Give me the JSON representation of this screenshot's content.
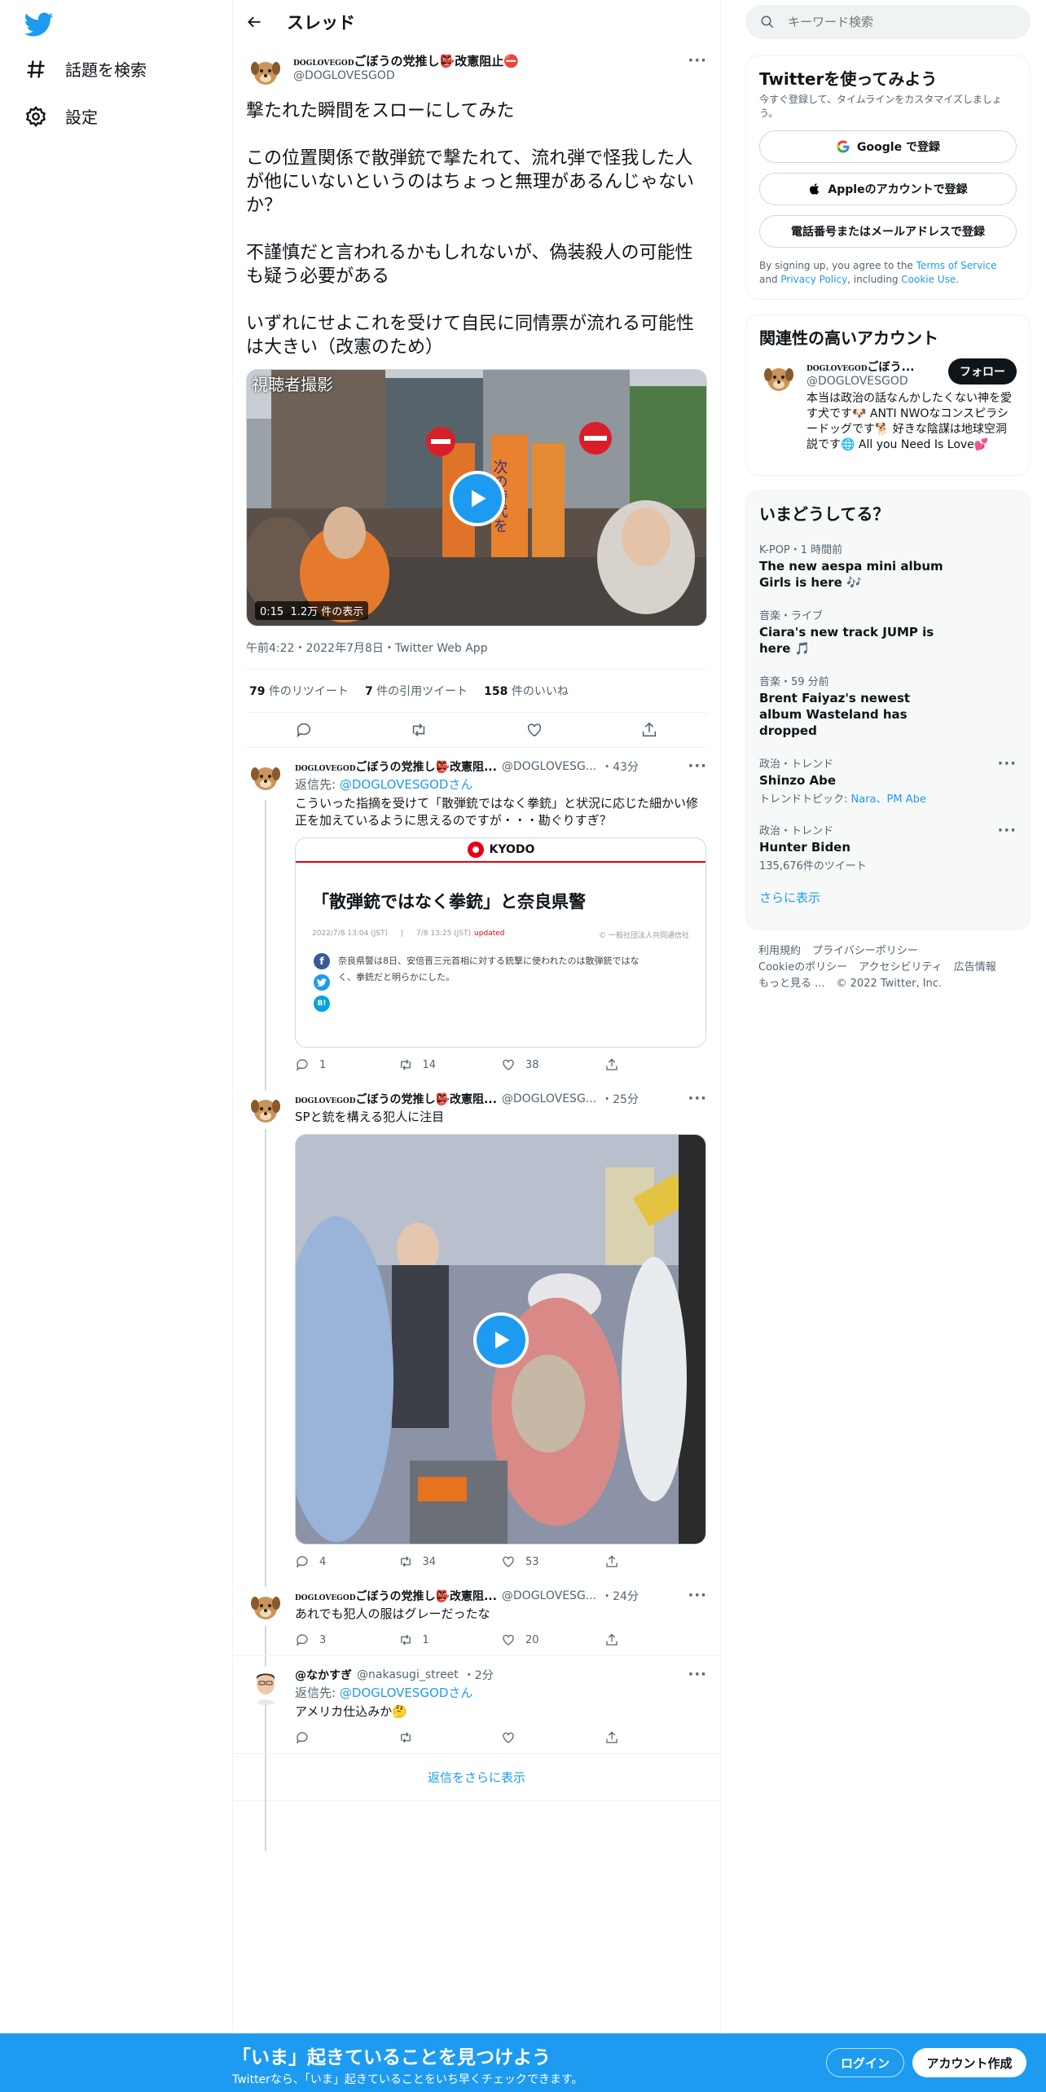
{
  "nav": {
    "explore": "話題を検索",
    "settings": "設定"
  },
  "header": {
    "title": "スレッド"
  },
  "main_tweet": {
    "name_small": "DOGLOVEGOD",
    "name_main": "ごぼうの党推し👺改憲阻止⛔",
    "handle": "@DOGLOVESGOD",
    "text": "撃たれた瞬間をスローにしてみた\n\nこの位置関係で散弾銃で撃たれて、流れ弾で怪我した人が他にいないというのはちょっと無理があるんじゃないか？\n\n不謹慎だと言われるかもしれないが、偽装殺人の可能性も疑う必要がある\n\nいずれにせよこれを受けて自民に同情票が流れる可能性は大きい（改憲のため）",
    "video_caption": "視聴者撮影",
    "video_duration": "0:15",
    "video_views": "1.2万 件の表示",
    "sign_text": "次の時代を",
    "timestamp": "午前4:22・2022年7月8日・Twitter Web App",
    "retweets": "79",
    "retweets_label": "件のリツイート",
    "quotes": "7",
    "quotes_label": "件の引用ツイート",
    "likes": "158",
    "likes_label": "件のいいね"
  },
  "replies": [
    {
      "name_small": "DOGLOVEGOD",
      "name_main": "ごぼうの党推し👺改憲阻...",
      "handle": "@DOGLOVESG...",
      "time": "・43分",
      "reply_to_prefix": "返信先: ",
      "reply_to_handle": "@DOGLOVESGOD",
      "reply_to_suffix": "さん",
      "text": "こういった指摘を受けて「散弾銃ではなく拳銃」と状況に応じた細かい修正を加えているように思えるのですが・・・勘ぐりすぎ？",
      "card": {
        "brand": "KYODO",
        "headline": "「散弾銃ではなく拳銃」と奈良県警",
        "date": "2022/7/8 13:04 (JST)",
        "updated_date": "7/8 13:25 (JST)",
        "updated": "updated",
        "credit": "© 一般社団法人共同通信社",
        "body": "奈良県警は8日、安倍晋三元首相に対する銃撃に使われたのは散弾銃ではなく、拳銃だと明らかにした。"
      },
      "replies": "1",
      "retweets": "14",
      "likes": "38"
    },
    {
      "name_small": "DOGLOVEGOD",
      "name_main": "ごぼうの党推し👺改憲阻...",
      "handle": "@DOGLOVESG...",
      "time": "・25分",
      "text": "SPと銃を構える犯人に注目",
      "replies": "4",
      "retweets": "34",
      "likes": "53"
    },
    {
      "name_small": "DOGLOVEGOD",
      "name_main": "ごぼうの党推し👺改憲阻...",
      "handle": "@DOGLOVESG...",
      "time": "・24分",
      "text": "あれでも犯人の服はグレーだったな",
      "replies": "3",
      "retweets": "1",
      "likes": "20"
    },
    {
      "name_main": "@なかすぎ",
      "handle": "@nakasugi_street",
      "time": "・2分",
      "reply_to_prefix": "返信先: ",
      "reply_to_handle": "@DOGLOVESGOD",
      "reply_to_suffix": "さん",
      "text": "アメリカ仕込みか🤔",
      "replies": "",
      "retweets": "",
      "likes": ""
    }
  ],
  "show_more_replies": "返信をさらに表示",
  "search": {
    "placeholder": "キーワード検索"
  },
  "signup": {
    "title": "Twitterを使ってみよう",
    "subtitle": "今すぐ登録して、タイムラインをカスタマイズしましょう。",
    "google": "Google で登録",
    "apple": "Appleのアカウントで登録",
    "phone": "電話番号またはメールアドレスで登録",
    "legal_1": "By signing up, you agree to the ",
    "terms": "Terms of Service",
    "legal_2": " and ",
    "privacy": "Privacy Policy",
    "legal_3": ", including ",
    "cookie": "Cookie Use",
    "legal_4": "."
  },
  "related": {
    "title": "関連性の高いアカウント",
    "name_small": "DOGLOVEGOD",
    "name_main": "ごぼう...",
    "handle": "@DOGLOVESGOD",
    "follow": "フォロー",
    "bio": "本当は政治の話なんかしたくない神を愛す犬です🐶 ANTI NWOなコンスピラシードッグです🐕 好きな陰謀は地球空洞説です🌐 All you Need Is Love💕"
  },
  "trends": {
    "title": "いまどうしてる？",
    "items": [
      {
        "category": "K-POP・1 時間前",
        "title": "The new aespa mini album Girls is here 🎶",
        "sub": ""
      },
      {
        "category": "音楽・ライブ",
        "title": "Ciara's new track JUMP is here 🎵",
        "sub": ""
      },
      {
        "category": "音楽・59 分前",
        "title": "Brent Faiyaz's newest album Wasteland has dropped",
        "sub": ""
      },
      {
        "category": "政治・トレンド",
        "title": "Shinzo Abe",
        "sub_prefix": "トレンドトピック: ",
        "sub_links": "Nara、PM Abe"
      },
      {
        "category": "政治・トレンド",
        "title": "Hunter Biden",
        "sub": "135,676件のツイート"
      }
    ],
    "show_more": "さらに表示"
  },
  "footer": {
    "terms": "利用規約",
    "privacy": "プライバシーポリシー",
    "cookie": "Cookieのポリシー",
    "accessibility": "アクセシビリティ",
    "ads": "広告情報",
    "more": "もっと見る ...",
    "copyright": "© 2022 Twitter, Inc."
  },
  "bottom_bar": {
    "title": "「いま」起きていることを見つけよう",
    "subtitle": "Twitterなら、「いま」起きていることをいち早くチェックできます。",
    "login": "ログイン",
    "signup": "アカウント作成"
  },
  "colors": {
    "accent": "#1d9bf0",
    "text": "#0f1419",
    "muted": "#536471",
    "kyodo_red": "#e60012"
  }
}
